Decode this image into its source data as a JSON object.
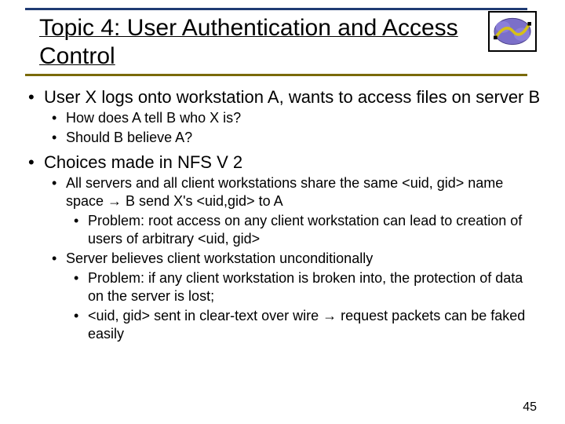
{
  "title": "Topic 4: User Authentication and Access Control",
  "bullets": [
    {
      "text": "User X logs onto workstation A, wants to access files on server B",
      "children": [
        {
          "text": "How does A tell B who X is?"
        },
        {
          "text": "Should B believe A?"
        }
      ]
    },
    {
      "text": "Choices made in NFS V 2",
      "children": [
        {
          "text": "All servers and all client workstations share the same <uid, gid> name space → B send X's <uid,gid> to A",
          "children": [
            {
              "text": "Problem: root access on any client workstation can lead to creation of users of arbitrary <uid, gid>"
            }
          ]
        },
        {
          "text": "Server believes client workstation unconditionally",
          "children": [
            {
              "text": "Problem: if any client workstation is broken into, the protection of data on the server is lost;"
            },
            {
              "text": "<uid, gid> sent in clear-text over wire → request packets can be faked easily"
            }
          ]
        }
      ]
    }
  ],
  "page_number": "45"
}
